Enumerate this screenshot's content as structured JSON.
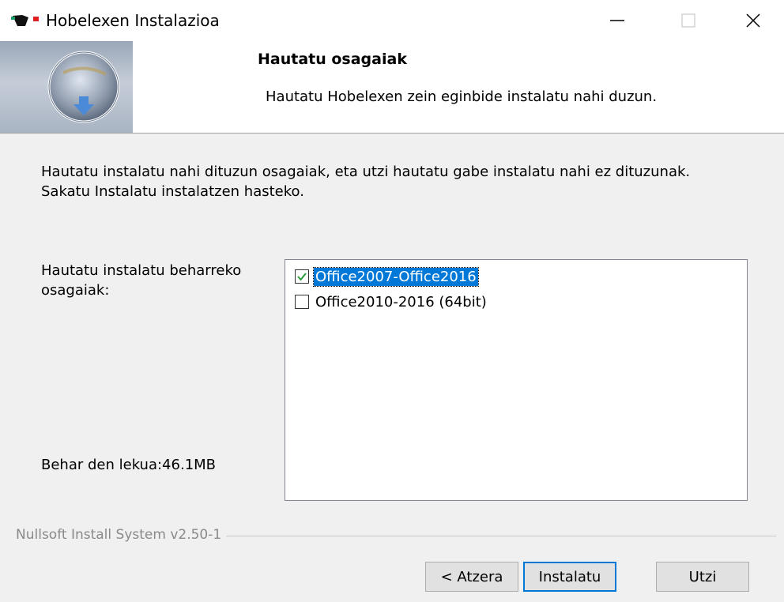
{
  "window": {
    "title": "Hobelexen Instalazioa",
    "controls": {
      "minimize": "—",
      "maximize": "☐",
      "close": "✕"
    }
  },
  "header": {
    "title": "Hautatu osagaiak",
    "subtitle": "Hautatu Hobelexen zein eginbide instalatu nahi duzun."
  },
  "body": {
    "intro_line1": "Hautatu instalatu nahi dituzun osagaiak, eta utzi hautatu gabe instalatu nahi ez dituzunak.",
    "intro_line2": "Sakatu Instalatu instalatzen hasteko.",
    "select_label": "Hautatu instalatu beharreko osagaiak:",
    "space_required": "Behar den lekua:46.1MB"
  },
  "components": [
    {
      "label": "Office2007-Office2016",
      "checked": true,
      "selected": true
    },
    {
      "label": "Office2010-2016 (64bit)",
      "checked": false,
      "selected": false
    }
  ],
  "footer": {
    "branding": "Nullsoft Install System v2.50-1"
  },
  "buttons": {
    "back": "< Atzera",
    "install": "Instalatu",
    "cancel": "Utzi"
  },
  "colors": {
    "accent": "#0078d7",
    "checkmark": "#2a9d3a",
    "background": "#f0f0f0"
  }
}
